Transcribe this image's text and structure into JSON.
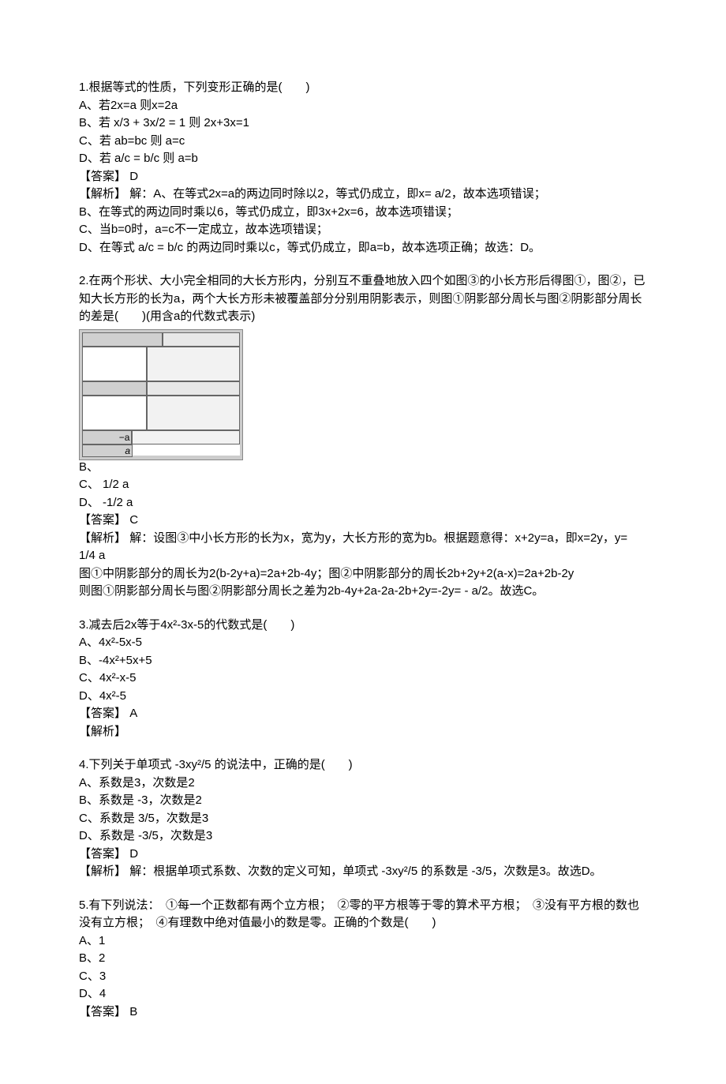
{
  "q1": {
    "stem": "1.根据等式的性质，下列变形正确的是(　　)",
    "a": "A、若2x=a 则x=2a",
    "b": "B、若 x/3 + 3x/2 = 1 则 2x+3x=1",
    "c": "C、若 ab=bc 则 a=c",
    "d": "D、若 a/c = b/c 则 a=b",
    "ans_label": "【答案】",
    "ans": "D",
    "exp_label": "【解析】",
    "exp_a": "解：A、在等式2x=a的两边同时除以2，等式仍成立，即x= a/2，故本选项错误；",
    "exp_b": "B、在等式的两边同时乘以6，等式仍成立，即3x+2x=6，故本选项错误；",
    "exp_c": "C、当b=0时，a=c不一定成立，故本选项错误；",
    "exp_d": "D、在等式 a/c = b/c 的两边同时乘以c，等式仍成立，即a=b，故本选项正确；故选：D。"
  },
  "q2": {
    "stem1": "2.在两个形状、大小完全相同的大长方形内，分别互不重叠地放入四个如图③的小长方形后得图①，图②，已知大长方形的长为a，两个大长方形未被覆盖部分分别用阴影表示，则图①阴影部分周长与图②阴影部分周长的差是(　　)(用含a的代数式表示)",
    "b": "B、",
    "c": "C、 1/2 a",
    "d": "D、 -1/2 a",
    "ans_label": "【答案】",
    "ans": "C",
    "exp_label": "【解析】",
    "exp_1": "解：设图③中小长方形的长为x，宽为y，大长方形的宽为b。根据题意得：x+2y=a，即x=2y，y= 1/4 a",
    "exp_2": "图①中阴影部分的周长为2(b-2y+a)=2a+2b-4y；图②中阴影部分的周长2b+2y+2(a-x)=2a+2b-2y",
    "exp_3": "则图①阴影部分周长与图②阴影部分周长之差为2b-4y+2a-2a-2b+2y=-2y= - a/2。故选C。"
  },
  "q3": {
    "stem": "3.减去后2x等于4x²-3x-5的代数式是(　　)",
    "a": "A、4x²-5x-5",
    "b": "B、-4x²+5x+5",
    "c": "C、4x²-x-5",
    "d": "D、4x²-5",
    "ans_label": "【答案】",
    "ans": "A",
    "exp_label": "【解析】"
  },
  "q4": {
    "stem": "4.下列关于单项式 -3xy²/5 的说法中，正确的是(　　)",
    "a": "A、系数是3，次数是2",
    "b": "B、系数是 -3，次数是2",
    "c": "C、系数是 3/5，次数是3",
    "d": "D、系数是 -3/5，次数是3",
    "ans_label": "【答案】",
    "ans": "D",
    "exp_label": "【解析】",
    "exp": "解：根据单项式系数、次数的定义可知，单项式 -3xy²/5 的系数是 -3/5，次数是3。故选D。"
  },
  "q5": {
    "stem": "5.有下列说法：　①每一个正数都有两个立方根；　②零的平方根等于零的算术平方根；　③没有平方根的数也没有立方根；　④有理数中绝对值最小的数是零。正确的个数是(　　)",
    "a": "A、1",
    "b": "B、2",
    "c": "C、3",
    "d": "D、4",
    "ans_label": "【答案】",
    "ans": "B"
  }
}
